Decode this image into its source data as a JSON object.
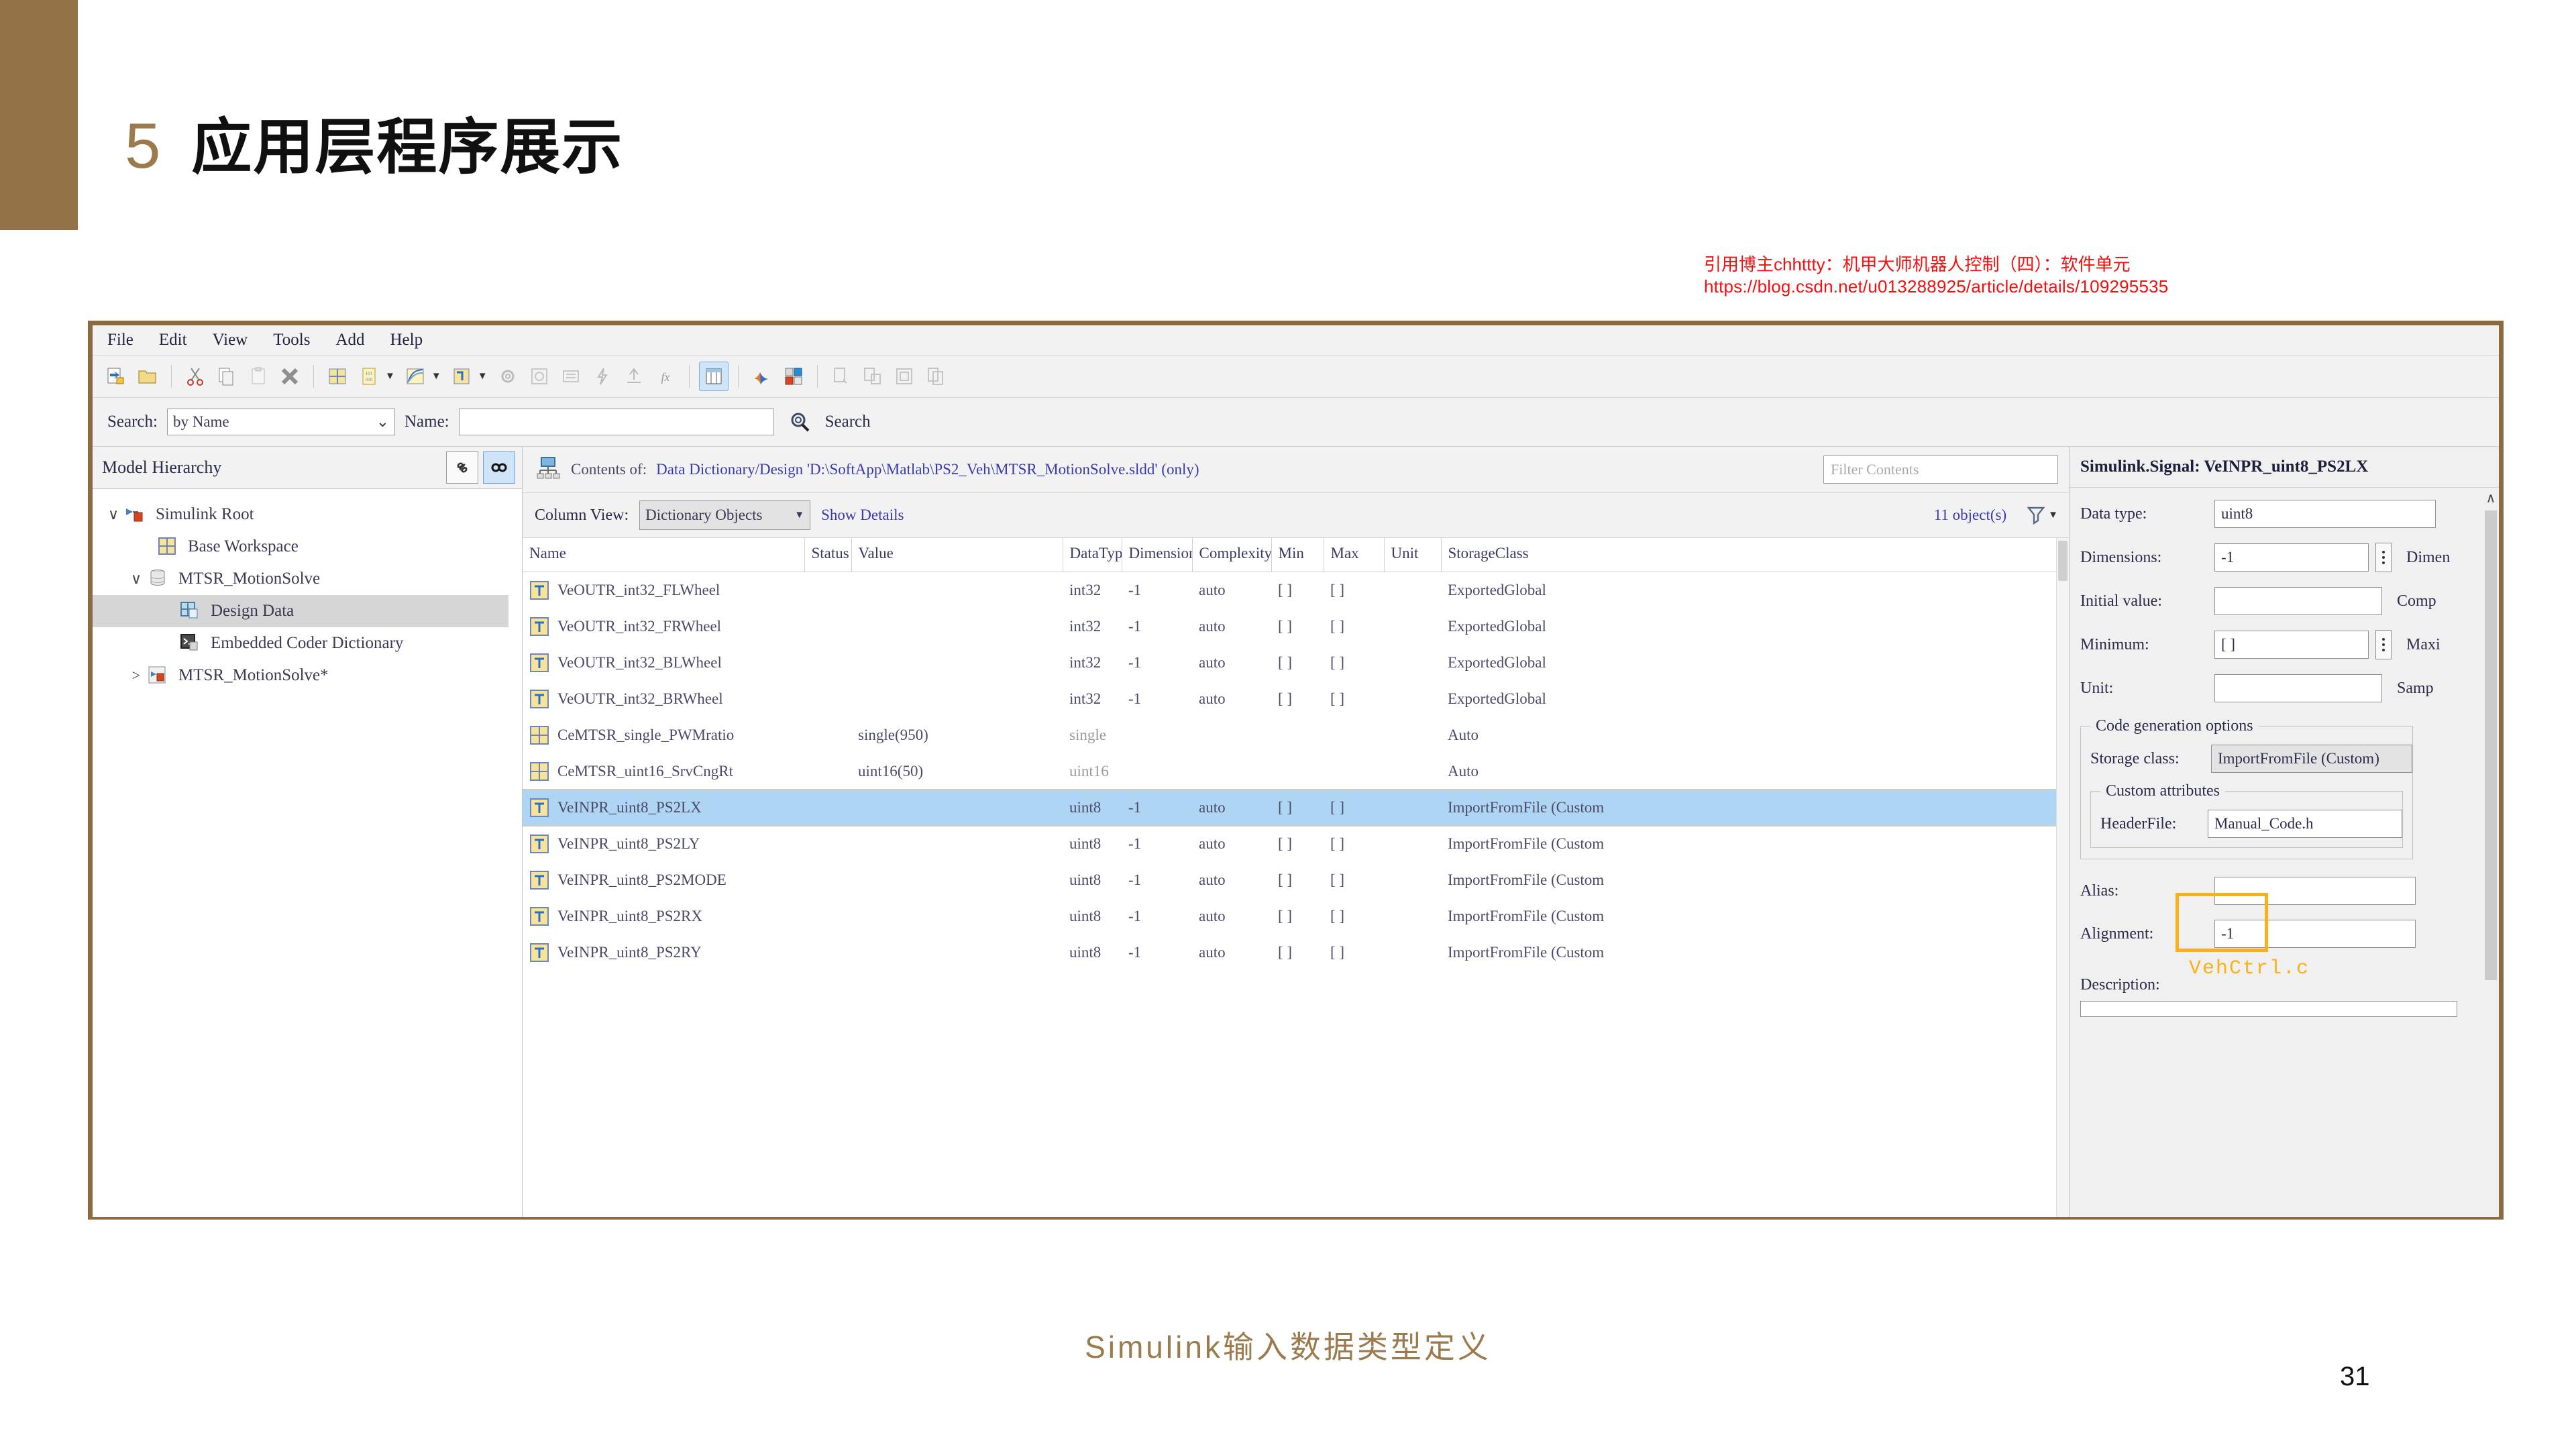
{
  "slide": {
    "number_marker": "5",
    "title": "应用层程序展示",
    "caption": "Simulink输入数据类型定义",
    "page_number": "31",
    "accent_color": "#927246",
    "reference_note_line1": "引用博主chhttty：机甲大师机器人控制（四）：软件单元",
    "reference_note_line2": "https://blog.csdn.net/u013288925/article/details/109295535",
    "reference_color": "#f60f0f"
  },
  "app": {
    "menu": [
      "File",
      "Edit",
      "View",
      "Tools",
      "Add",
      "Help"
    ],
    "toolbar_icons": [
      "new-model-icon",
      "open-folder-icon",
      "cut-icon",
      "copy-icon",
      "paste-icon",
      "delete-x-icon",
      "base-workspace-icon",
      "data-dictionary-icon",
      "signal-plot-icon",
      "simulink-object-icon",
      "settings-gear-icon",
      "target-icon",
      "list-icon",
      "lightning-icon",
      "import-icon",
      "function-fx-icon",
      "column-view-icon",
      "matlab-icon",
      "coder-icon",
      "compare-icon",
      "merge-icon",
      "export-icon",
      "report-icon"
    ],
    "search": {
      "search_label": "Search:",
      "search_by_value": "by Name",
      "name_label": "Name:",
      "name_value": "",
      "search_button": "Search"
    }
  },
  "hierarchy": {
    "panel_title": "Model Hierarchy",
    "buttons": [
      "link-icon",
      "glasses-icon"
    ],
    "items": [
      {
        "label": "Simulink Root",
        "icon": "simulink-root-icon",
        "arrow": "∨",
        "indent": 0,
        "selected": false
      },
      {
        "label": "Base Workspace",
        "icon": "workspace-grid-icon",
        "arrow": "",
        "indent": 1,
        "selected": false
      },
      {
        "label": "MTSR_MotionSolve",
        "icon": "data-dictionary-icon",
        "arrow": "∨",
        "indent": 1,
        "selected": false
      },
      {
        "label": "Design Data",
        "icon": "design-data-icon",
        "arrow": "",
        "indent": 2,
        "selected": true
      },
      {
        "label": "Embedded Coder Dictionary",
        "icon": "coder-dictionary-icon",
        "arrow": "",
        "indent": 2,
        "selected": false
      },
      {
        "label": "MTSR_MotionSolve*",
        "icon": "model-icon",
        "arrow": ">",
        "indent": 1,
        "selected": false
      }
    ]
  },
  "contents": {
    "contents_label": "Contents of:",
    "contents_path": "Data Dictionary/Design 'D:\\SoftApp\\Matlab\\PS2_Veh\\MTSR_MotionSolve.sldd'  (only)",
    "filter_placeholder": "Filter Contents",
    "column_view_label": "Column View:",
    "column_view_value": "Dictionary Objects",
    "show_details_link": "Show Details",
    "object_count": "11 object(s)",
    "filter_icon": "funnel-icon",
    "columns": [
      "Name",
      "Status",
      "Value",
      "DataType",
      "Dimensions",
      "Complexity",
      "Min",
      "Max",
      "Unit",
      "StorageClass"
    ],
    "rows": [
      {
        "name": "VeOUTR_int32_FLWheel",
        "status": "",
        "value": "",
        "datatype": "int32",
        "dimensions": "-1",
        "complexity": "auto",
        "min": "[ ]",
        "max": "[ ]",
        "unit": "",
        "storageclass": "ExportedGlobal",
        "icon": "signal-icon",
        "selected": false
      },
      {
        "name": "VeOUTR_int32_FRWheel",
        "status": "",
        "value": "",
        "datatype": "int32",
        "dimensions": "-1",
        "complexity": "auto",
        "min": "[ ]",
        "max": "[ ]",
        "unit": "",
        "storageclass": "ExportedGlobal",
        "icon": "signal-icon",
        "selected": false
      },
      {
        "name": "VeOUTR_int32_BLWheel",
        "status": "",
        "value": "",
        "datatype": "int32",
        "dimensions": "-1",
        "complexity": "auto",
        "min": "[ ]",
        "max": "[ ]",
        "unit": "",
        "storageclass": "ExportedGlobal",
        "icon": "signal-icon",
        "selected": false
      },
      {
        "name": "VeOUTR_int32_BRWheel",
        "status": "",
        "value": "",
        "datatype": "int32",
        "dimensions": "-1",
        "complexity": "auto",
        "min": "[ ]",
        "max": "[ ]",
        "unit": "",
        "storageclass": "ExportedGlobal",
        "icon": "signal-icon",
        "selected": false
      },
      {
        "name": "CeMTSR_single_PWMratio",
        "status": "",
        "value": "single(950)",
        "datatype": "single",
        "dimensions": "",
        "complexity": "",
        "min": "",
        "max": "",
        "unit": "",
        "storageclass": "Auto",
        "icon": "parameter-icon",
        "selected": false
      },
      {
        "name": "CeMTSR_uint16_SrvCngRt",
        "status": "",
        "value": "uint16(50)",
        "datatype": "uint16",
        "dimensions": "",
        "complexity": "",
        "min": "",
        "max": "",
        "unit": "",
        "storageclass": "Auto",
        "icon": "parameter-icon",
        "selected": false
      },
      {
        "name": "VeINPR_uint8_PS2LX",
        "status": "",
        "value": "",
        "datatype": "uint8",
        "dimensions": "-1",
        "complexity": "auto",
        "min": "[ ]",
        "max": "[ ]",
        "unit": "",
        "storageclass": "ImportFromFile (Custom",
        "icon": "signal-icon",
        "selected": true
      },
      {
        "name": "VeINPR_uint8_PS2LY",
        "status": "",
        "value": "",
        "datatype": "uint8",
        "dimensions": "-1",
        "complexity": "auto",
        "min": "[ ]",
        "max": "[ ]",
        "unit": "",
        "storageclass": "ImportFromFile (Custom",
        "icon": "signal-icon",
        "selected": false
      },
      {
        "name": "VeINPR_uint8_PS2MODE",
        "status": "",
        "value": "",
        "datatype": "uint8",
        "dimensions": "-1",
        "complexity": "auto",
        "min": "[ ]",
        "max": "[ ]",
        "unit": "",
        "storageclass": "ImportFromFile (Custom",
        "icon": "signal-icon",
        "selected": false
      },
      {
        "name": "VeINPR_uint8_PS2RX",
        "status": "",
        "value": "",
        "datatype": "uint8",
        "dimensions": "-1",
        "complexity": "auto",
        "min": "[ ]",
        "max": "[ ]",
        "unit": "",
        "storageclass": "ImportFromFile (Custom",
        "icon": "signal-icon",
        "selected": false
      },
      {
        "name": "VeINPR_uint8_PS2RY",
        "status": "",
        "value": "",
        "datatype": "uint8",
        "dimensions": "-1",
        "complexity": "auto",
        "min": "[ ]",
        "max": "[ ]",
        "unit": "",
        "storageclass": "ImportFromFile (Custom",
        "icon": "signal-icon",
        "selected": false
      }
    ]
  },
  "properties": {
    "title": "Simulink.Signal: VeINPR_uint8_PS2LX",
    "data_type_label": "Data type:",
    "data_type_value": "uint8",
    "dimensions_label": "Dimensions:",
    "dimensions_value": "-1",
    "dimensions_mode_label": "Dimen",
    "initial_value_label": "Initial value:",
    "initial_value": "",
    "complexity_label": "Comp",
    "minimum_label": "Minimum:",
    "minimum_value": "[ ]",
    "maximum_label": "Maxi",
    "unit_label": "Unit:",
    "unit_value": "",
    "sample_label": "Samp",
    "codegen_group": "Code generation options",
    "storage_class_label": "Storage class:",
    "storage_class_value": "ImportFromFile (Custom)",
    "custom_attributes_group": "Custom attributes",
    "header_file_label": "HeaderFile:",
    "header_file_value": "Manual_Code.h",
    "alias_label": "Alias:",
    "alias_value": "",
    "alignment_label": "Alignment:",
    "alignment_value": "-1",
    "description_label": "Description:",
    "annotation_text": "VehCtrl.c",
    "annotation_color": "#fcb017"
  }
}
